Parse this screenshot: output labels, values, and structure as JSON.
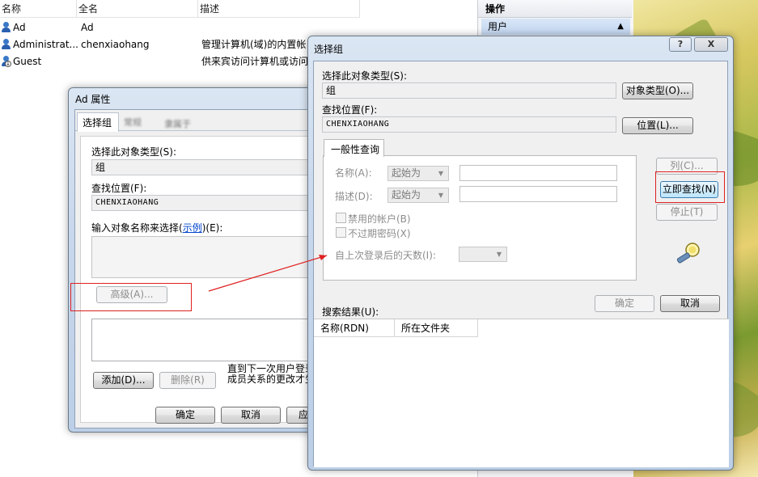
{
  "mmc": {
    "columns": [
      "名称",
      "全名",
      "描述"
    ],
    "rows": [
      {
        "name": "Ad",
        "fullname": "Ad",
        "description": ""
      },
      {
        "name": "Administrat...",
        "fullname": "chenxiaohang",
        "description": "管理计算机(域)的内置帐"
      },
      {
        "name": "Guest",
        "fullname": "",
        "description": "供来宾访问计算机或访问"
      }
    ],
    "actions_title": "操作",
    "actions_users": "用户"
  },
  "ad_props": {
    "title": "Ad 属性",
    "inner_tab": "选择组",
    "object_type_label": "选择此对象类型(S):",
    "object_type_value": "组",
    "location_label": "查找位置(F):",
    "location_value": "CHENXIAOHANG",
    "enter_names_label": "输入对象名称来选择(",
    "enter_names_link": "示例",
    "enter_names_suffix": ")(E):",
    "advanced_btn": "高级(A)...",
    "add_btn": "添加(D)...",
    "remove_btn": "删除(R)",
    "note_line1": "直到下一次用户登录",
    "note_line2": "成员关系的更改才生",
    "ok_btn": "确定",
    "cancel_btn": "取消",
    "apply_btn": "应"
  },
  "select_group": {
    "title": "选择组",
    "help_btn": "?",
    "close_btn": "X",
    "object_type_label": "选择此对象类型(S):",
    "object_type_value": "组",
    "object_type_btn": "对象类型(O)...",
    "location_label": "查找位置(F):",
    "location_value": "CHENXIAOHANG",
    "location_btn": "位置(L)...",
    "query_tab": "一般性查询",
    "name_label": "名称(A):",
    "name_mode": "起始为",
    "desc_label": "描述(D):",
    "desc_mode": "起始为",
    "disabled_accounts": "禁用的帐户(B)",
    "no_expire_password": "不过期密码(X)",
    "days_since_login": "自上次登录后的天数(I):",
    "columns_btn": "列(C)...",
    "find_now_btn": "立即查找(N)",
    "stop_btn": "停止(T)",
    "ok_btn": "确定",
    "cancel_btn": "取消",
    "results_label": "搜索结果(U):",
    "results_columns": [
      "名称(RDN)",
      "所在文件夹"
    ]
  },
  "annotation_color": "#e02020"
}
